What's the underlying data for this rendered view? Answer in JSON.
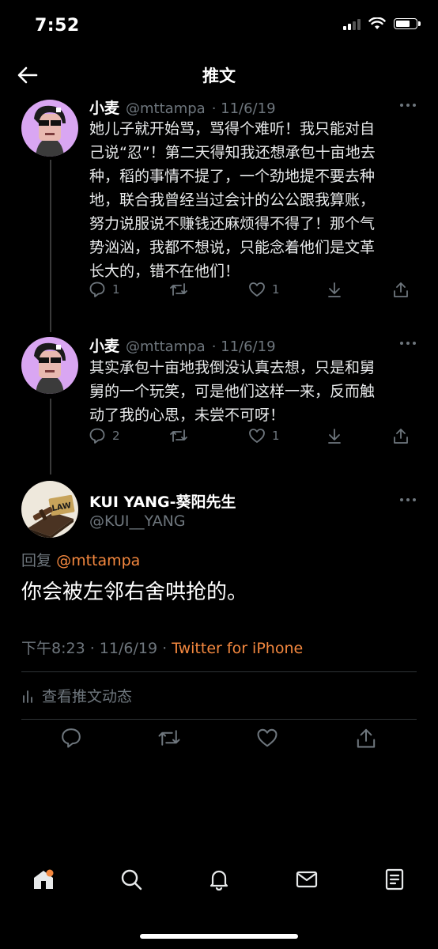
{
  "status_bar": {
    "time": "7:52"
  },
  "header": {
    "title": "推文"
  },
  "thread": [
    {
      "name": "小麦",
      "handle": "@mttampa",
      "date": "· 11/6/19",
      "text_lines": [
        "她儿子就开始骂，骂得个难听！我只能对自",
        "己说“忍”！第二天得知我还想承包十亩地去",
        "种，稻的事情不提了，一个劲地提不要去种",
        "地，联合我曾经当过会计的公公跟我算账，",
        "努力说服说不赚钱还麻烦得不得了！那个气",
        "势汹汹，我都不想说，只能念着他们是文革",
        "长大的，错不在他们！"
      ],
      "replies": "1",
      "retweets": "",
      "likes": "1"
    },
    {
      "name": "小麦",
      "handle": "@mttampa",
      "date": "· 11/6/19",
      "text_lines": [
        "其实承包十亩地我倒没认真去想，只是和舅",
        "舅的一个玩笑，可是他们这样一来，反而触",
        "动了我的心思，未尝不可呀！"
      ],
      "replies": "2",
      "retweets": "",
      "likes": "1"
    }
  ],
  "main_tweet": {
    "name": "KUI YANG-葵阳先生",
    "handle": "@KUI__YANG",
    "avatar_text": "LAW",
    "reply_prefix": "回复",
    "reply_mention": "@mttampa",
    "text": "你会被左邻右舍哄抢的。",
    "time": "下午8:23 · 11/6/19 ·",
    "source": "Twitter for iPhone",
    "activity_label": "查看推文动态"
  },
  "colors": {
    "accent": "#f4883f",
    "muted": "#6e767d",
    "background": "#000000",
    "avatar_bg": "#d9a6f2"
  },
  "icons": [
    "back-arrow-icon",
    "reply-icon",
    "retweet-icon",
    "like-icon",
    "share-icon",
    "more-icon",
    "home-icon",
    "search-icon",
    "notifications-icon",
    "messages-icon",
    "lists-icon"
  ]
}
